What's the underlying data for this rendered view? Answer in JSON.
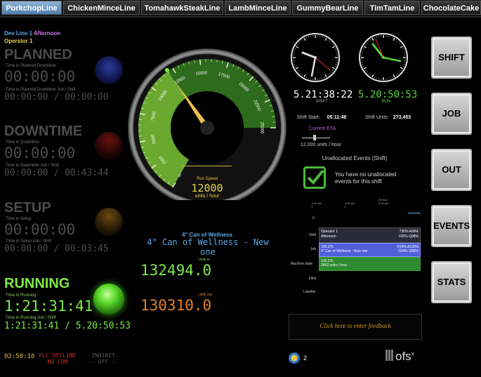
{
  "tabs": [
    "PorkchopLine",
    "ChickenMinceLine",
    "TomahawkSteakLine",
    "LambMinceLine",
    "GummyBearLine",
    "TimTamLine",
    "ChocolateCake"
  ],
  "header": {
    "line": "Dev Line 1",
    "shift_name": "Afternoon",
    "operator": "Operstor 1"
  },
  "states": {
    "planned": {
      "title": "PLANNED",
      "time_label": "Time in Planned Downtime",
      "time": "00:00:00",
      "job_label": "Time in Planned Downtime Job / Shift",
      "job_time": "00:00:00 / 00:00:00"
    },
    "downtime": {
      "title": "DOWNTIME",
      "time_label": "Time in Downtime",
      "time": "00:00:00",
      "job_label": "Time in Downtime Job / Shift",
      "job_time": "00:00:00 / 00:43:44"
    },
    "setup": {
      "title": "SETUP",
      "time_label": "Time in Setup",
      "time": "00:00:00",
      "job_label": "Time in Setup Job / Shift",
      "job_time": "00:00:00 / 00:03:45"
    },
    "running": {
      "title": "RUNNING",
      "time_label": "Time in Running",
      "time": "1:21:31:41",
      "job_label": "Time in Running Job / Shift",
      "job_time": "1:21:31:41 / 5.20:50:53"
    }
  },
  "footer": {
    "clock": "02:50:10",
    "plc_status": "PLC-OFFLINE",
    "plc_sub": "NO COM",
    "inhibit": "INHIBIT",
    "inhibit_state": "OFF",
    "alert_count": "2",
    "brand": "ofs"
  },
  "gauge": {
    "ticks": [
      "0",
      "2500",
      "5000",
      "7500",
      "10000",
      "12500",
      "15000",
      "17500",
      "20000",
      "22500",
      "25000"
    ],
    "run_speed_label": "Run Speed",
    "run_speed": "12000",
    "units": "units / hour",
    "value": 12000,
    "max": 25000
  },
  "product": {
    "title": "4\" Can of Wellness",
    "subtitle": "4\" Can of Wellness - New one"
  },
  "counters": {
    "in_label": "units in",
    "in_value": "132494.0",
    "out_label": "units out",
    "out_value": "130310.0"
  },
  "clocks": {
    "shift": {
      "time": "5.21:38:22",
      "label": "SHIFT"
    },
    "run": {
      "time": "5.20:50:53",
      "label": "RUN"
    }
  },
  "shift_info": {
    "start_label": "Shift Start:",
    "start": "05:11:48",
    "units_label": "Shift Units:",
    "units": "273,453",
    "eta_label": "Current ETA",
    "rate": "12,000 units / hour"
  },
  "unallocated": {
    "title": "Unallocated Events (Shift)",
    "message_line1": "You have no unallocated",
    "message_line2": "events for this shift"
  },
  "timeline": {
    "times": [
      "2:00 am",
      "3:00 am",
      "25 Nov\n2:00 am"
    ],
    "rows": [
      "0",
      "Shift",
      "Job",
      "Machine state",
      "Filler",
      "Labeller"
    ],
    "shift_block": {
      "line1": "Operator 1",
      "line2": "Afternoon",
      "stat1": "730% A99%",
      "stat2": "030% Q98%"
    },
    "job_block": {
      "line1": "130.27k",
      "line2": "4\" Can of Wellness - New one",
      "stat1": "P24% A100%",
      "stat2": "O24% Q98%"
    },
    "machine_block": {
      "line1": "130.27k",
      "line2": "2862 units / hour"
    }
  },
  "buttons": [
    "SHIFT",
    "JOB",
    "OUT",
    "EVENTS",
    "STATS"
  ],
  "feedback": "Click here to enter feedback",
  "colors": {
    "running": "#7ee84a",
    "gauge_green": "#5f9e2c",
    "out": "#e3812a",
    "product": "#5aa9e8"
  }
}
